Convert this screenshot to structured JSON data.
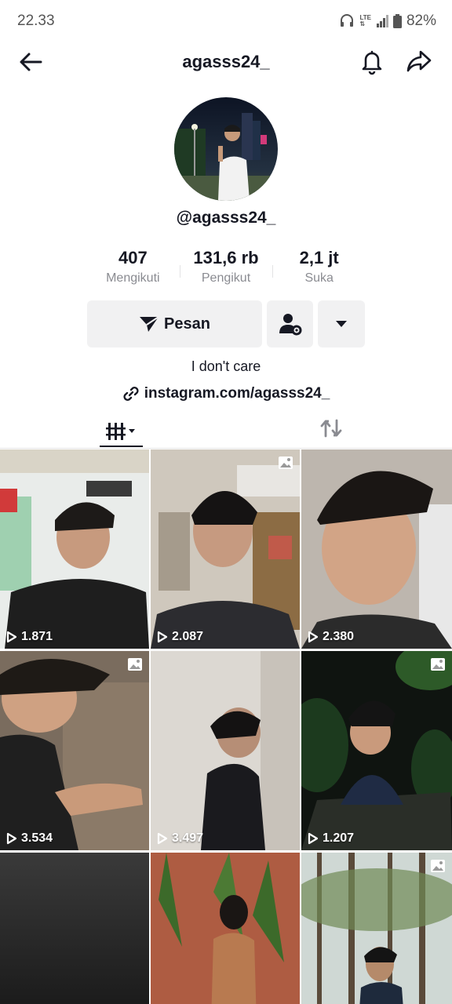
{
  "status_bar": {
    "time": "22.33",
    "battery": "82%",
    "network": "LTE",
    "icons": [
      "headphones-icon",
      "lte-icon",
      "signal-icon",
      "battery-icon"
    ]
  },
  "header": {
    "title": "agasss24_",
    "icons": [
      "back-arrow-icon",
      "bell-icon",
      "share-icon"
    ]
  },
  "profile": {
    "handle": "@agasss24_",
    "bio": "I don't care",
    "link": "instagram.com/agasss24_"
  },
  "stats": [
    {
      "value": "407",
      "label": "Mengikuti"
    },
    {
      "value": "131,6 rb",
      "label": "Pengikut"
    },
    {
      "value": "2,1 jt",
      "label": "Suka"
    }
  ],
  "actions": {
    "message_label": "Pesan"
  },
  "tabs": [
    {
      "name": "videos",
      "icon": "grid-sort-icon",
      "active": true
    },
    {
      "name": "reposts",
      "icon": "repost-icon",
      "active": false
    }
  ],
  "videos": [
    {
      "views": "1.871",
      "type": "video"
    },
    {
      "views": "2.087",
      "type": "photo"
    },
    {
      "views": "2.380",
      "type": "video"
    },
    {
      "views": "3.534",
      "type": "photo"
    },
    {
      "views": "3.497",
      "type": "video"
    },
    {
      "views": "1.207",
      "type": "photo"
    },
    {
      "views": "",
      "type": "video"
    },
    {
      "views": "",
      "type": "video"
    },
    {
      "views": "",
      "type": "photo"
    }
  ],
  "colors": {
    "text": "#161823",
    "secondary": "#8a8b91",
    "button_bg": "#f1f1f2"
  }
}
